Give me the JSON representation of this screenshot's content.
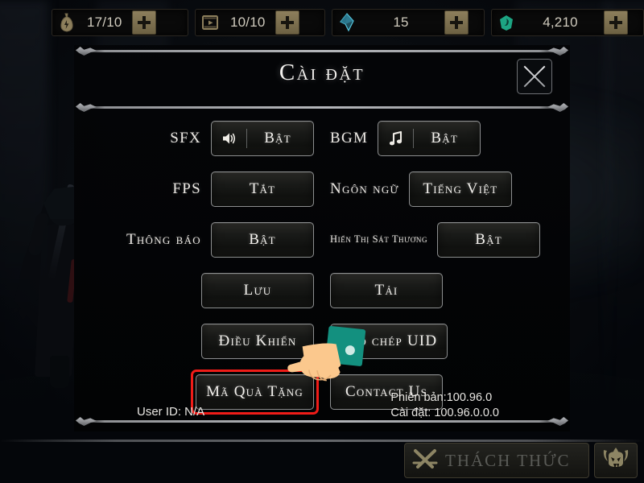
{
  "topbar": {
    "items": [
      {
        "icon": "stamina-pouch-icon",
        "value": "17/10",
        "plus": "+"
      },
      {
        "icon": "film-ticket-icon",
        "value": "10/10",
        "plus": "+"
      },
      {
        "icon": "crystal-gem-icon",
        "value": "15",
        "plus": "+"
      },
      {
        "icon": "green-soul-icon",
        "value": "4,210",
        "plus": "+"
      }
    ]
  },
  "dialog": {
    "title": "Cài đặt",
    "close_icon": "close-icon",
    "rows": [
      {
        "left": {
          "label": "SFX",
          "type": "toggle",
          "icon": "speaker-icon",
          "value": "Bật"
        },
        "right": {
          "label": "BGM",
          "type": "toggle",
          "icon": "music-note-icon",
          "value": "Bật"
        }
      },
      {
        "left": {
          "label": "FPS",
          "type": "button",
          "value": "Tắt"
        },
        "right": {
          "label": "Ngôn ngữ",
          "type": "button",
          "value": "Tiếng Việt"
        }
      },
      {
        "left": {
          "label": "Thông báo",
          "type": "button",
          "value": "Bật"
        },
        "right": {
          "label": "Hiển Thị Sát Thương",
          "label_small": true,
          "type": "button",
          "value": "Bật"
        }
      },
      {
        "left": {
          "label": "",
          "type": "button",
          "value": "Lưu"
        },
        "right": {
          "label": "",
          "type": "button",
          "value": "Tải"
        }
      },
      {
        "left": {
          "label": "",
          "type": "button",
          "value": "Điều Khiển"
        },
        "right": {
          "label": "",
          "type": "button",
          "value": "Sao chép UID"
        }
      },
      {
        "left": {
          "label": "",
          "type": "button",
          "value": "Mã Quà Tặng",
          "highlighted": true
        },
        "right": {
          "label": "",
          "type": "button",
          "value": "Contact Us"
        }
      }
    ],
    "footer": {
      "user_id": "User ID: N/A",
      "version": "Phiên bản:100.96.0",
      "settings_version": "Cài đặt: 100.96.0.0.0"
    }
  },
  "hud": {
    "challenge_label": "THÁCH THỨC",
    "challenge_icon": "crossed-swords-icon",
    "demon_icon": "demon-skull-icon"
  },
  "cursor": {
    "icon": "pointing-hand-icon"
  },
  "colors": {
    "highlight": "#ef1c18",
    "accent_gold": "#8d7f5c",
    "text": "#f2f0ec",
    "cursor_sleeve": "#13907f",
    "cursor_skin": "#fbc88d"
  }
}
